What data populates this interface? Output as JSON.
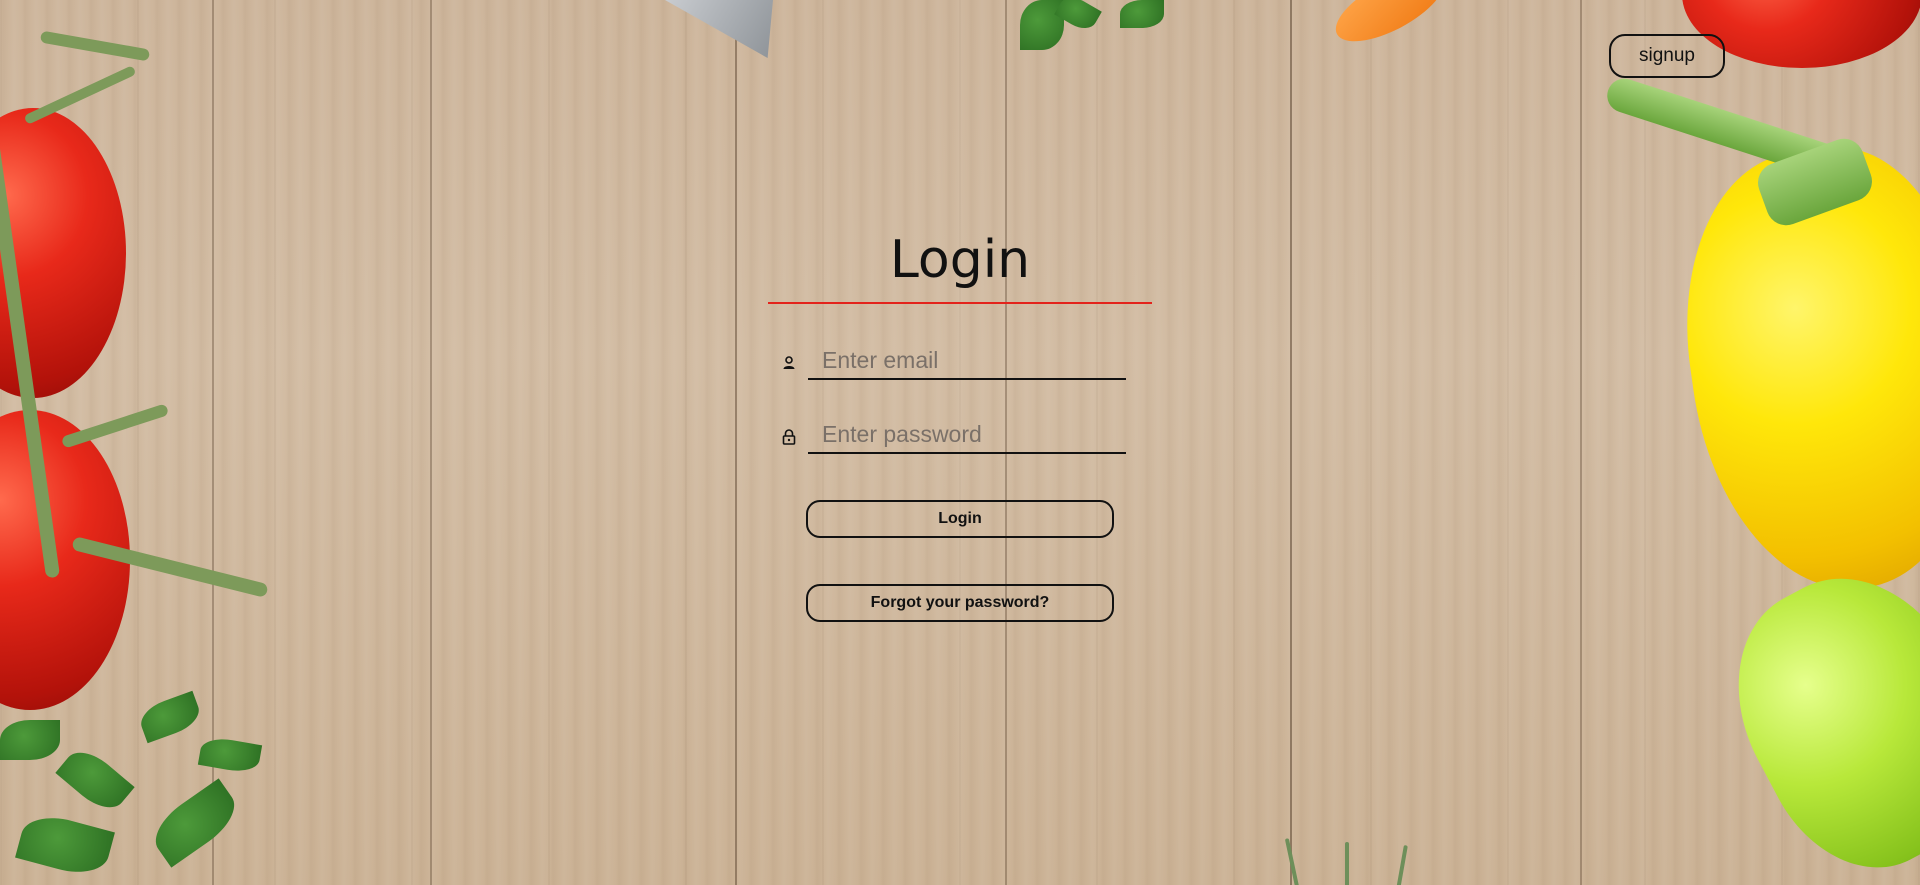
{
  "header": {
    "signup_label": "signup"
  },
  "login": {
    "title": "Login",
    "email_placeholder": "Enter email",
    "password_placeholder": "Enter password",
    "login_button_label": "Login",
    "forgot_password_label": "Forgot your password?",
    "underline_color": "#e3231b"
  },
  "icons": {
    "email": "user-icon",
    "password": "lock-icon"
  },
  "background": {
    "description_colors": {
      "wood": "#cdb59b"
    }
  }
}
